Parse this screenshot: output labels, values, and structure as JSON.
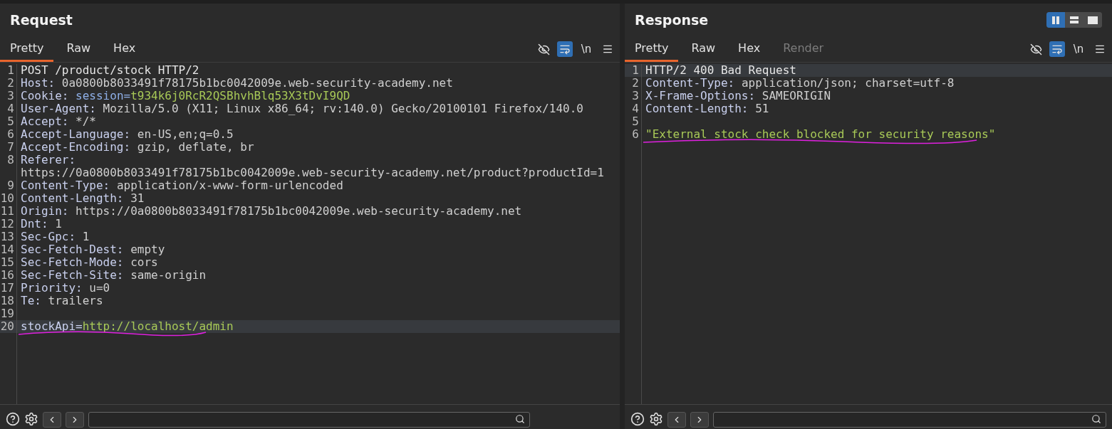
{
  "panes": [
    {
      "title": "Request",
      "tabs": [
        {
          "label": "Pretty",
          "selected": true,
          "disabled": false
        },
        {
          "label": "Raw",
          "selected": false,
          "disabled": false
        },
        {
          "label": "Hex",
          "selected": false,
          "disabled": false
        }
      ],
      "toolbar": {
        "wrap_on": true,
        "newline_label": "\\n"
      },
      "lines": [
        {
          "num": "1",
          "kind": "plain",
          "text": "POST /product/stock HTTP/2",
          "current": false
        },
        {
          "num": "2",
          "kind": "header",
          "key": "Host:",
          "value": "0a0800b8033491f78175b1bc0042009e.web-security-academy.net",
          "current": false
        },
        {
          "num": "3",
          "kind": "cookie",
          "key": "Cookie:",
          "name": "session=",
          "value": "t934k6j0RcR2QSBhvhBlq53X3tDvI9QD",
          "current": false
        },
        {
          "num": "4",
          "kind": "header",
          "key": "User-Agent:",
          "value": "Mozilla/5.0 (X11; Linux x86_64; rv:140.0) Gecko/20100101 Firefox/140.0",
          "current": false
        },
        {
          "num": "5",
          "kind": "header",
          "key": "Accept:",
          "value": "*/*",
          "current": false
        },
        {
          "num": "6",
          "kind": "header",
          "key": "Accept-Language:",
          "value": "en-US,en;q=0.5",
          "current": false
        },
        {
          "num": "7",
          "kind": "header",
          "key": "Accept-Encoding:",
          "value": "gzip, deflate, br",
          "current": false
        },
        {
          "num": "8",
          "kind": "wrapped",
          "key": "Referer:",
          "value": "https://0a0800b8033491f78175b1bc0042009e.web-security-academy.net/product?productId=1",
          "current": false
        },
        {
          "num": "9",
          "kind": "header",
          "key": "Content-Type:",
          "value": "application/x-www-form-urlencoded",
          "current": false
        },
        {
          "num": "10",
          "kind": "header",
          "key": "Content-Length:",
          "value": "31",
          "current": false
        },
        {
          "num": "11",
          "kind": "header",
          "key": "Origin:",
          "value": "https://0a0800b8033491f78175b1bc0042009e.web-security-academy.net",
          "current": false
        },
        {
          "num": "12",
          "kind": "header",
          "key": "Dnt:",
          "value": "1",
          "current": false
        },
        {
          "num": "13",
          "kind": "header",
          "key": "Sec-Gpc:",
          "value": "1",
          "current": false
        },
        {
          "num": "14",
          "kind": "header",
          "key": "Sec-Fetch-Dest:",
          "value": "empty",
          "current": false
        },
        {
          "num": "15",
          "kind": "header",
          "key": "Sec-Fetch-Mode:",
          "value": "cors",
          "current": false
        },
        {
          "num": "16",
          "kind": "header",
          "key": "Sec-Fetch-Site:",
          "value": "same-origin",
          "current": false
        },
        {
          "num": "17",
          "kind": "header",
          "key": "Priority:",
          "value": "u=0",
          "current": false
        },
        {
          "num": "18",
          "kind": "header",
          "key": "Te:",
          "value": "trailers",
          "current": false
        },
        {
          "num": "19",
          "kind": "blank",
          "current": false
        },
        {
          "num": "20",
          "kind": "param",
          "key": "stockApi=",
          "value": "http://localhost/admin",
          "current": true,
          "underlined": true
        }
      ]
    },
    {
      "title": "Response",
      "layout_buttons": [
        {
          "selected": true
        },
        {
          "selected": false
        },
        {
          "selected": false
        }
      ],
      "tabs": [
        {
          "label": "Pretty",
          "selected": true,
          "disabled": false
        },
        {
          "label": "Raw",
          "selected": false,
          "disabled": false
        },
        {
          "label": "Hex",
          "selected": false,
          "disabled": false
        },
        {
          "label": "Render",
          "selected": false,
          "disabled": true
        }
      ],
      "toolbar": {
        "wrap_on": true,
        "newline_label": "\\n"
      },
      "lines": [
        {
          "num": "1",
          "kind": "plain",
          "text": "HTTP/2 400 Bad Request",
          "current": true
        },
        {
          "num": "2",
          "kind": "header",
          "key": "Content-Type:",
          "value": "application/json; charset=utf-8",
          "current": false
        },
        {
          "num": "3",
          "kind": "header",
          "key": "X-Frame-Options:",
          "value": "SAMEORIGIN",
          "current": false
        },
        {
          "num": "4",
          "kind": "header",
          "key": "Content-Length:",
          "value": "51",
          "current": false
        },
        {
          "num": "5",
          "kind": "blank",
          "current": false
        },
        {
          "num": "6",
          "kind": "string",
          "text": "\"External stock check blocked for security reasons\"",
          "current": false,
          "underlined": true
        }
      ]
    }
  ]
}
